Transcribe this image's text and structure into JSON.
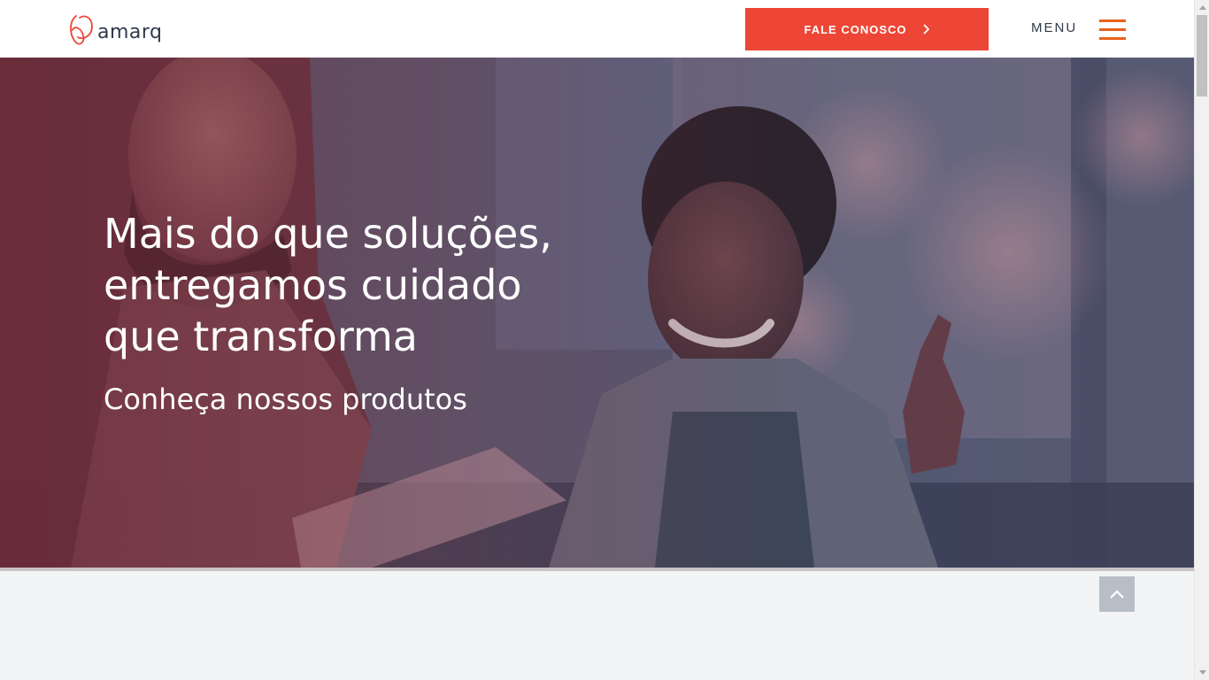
{
  "header": {
    "logo_text": "amarq",
    "cta_label": "FALE CONOSCO",
    "menu_label": "MENU"
  },
  "hero": {
    "title_lines": [
      "Mais do que soluções,",
      "entregamos cuidado",
      "que transforma"
    ],
    "subtitle": "Conheça nossos produtos"
  },
  "colors": {
    "accent": "#ee4636",
    "menu_icon": "#e8621a",
    "text_dark": "#2f3a4a",
    "back_to_top": "#b8bec8"
  },
  "icons": {
    "cta": "chevron-right-icon",
    "menu": "hamburger-icon",
    "back_to_top": "chevron-up-icon"
  }
}
